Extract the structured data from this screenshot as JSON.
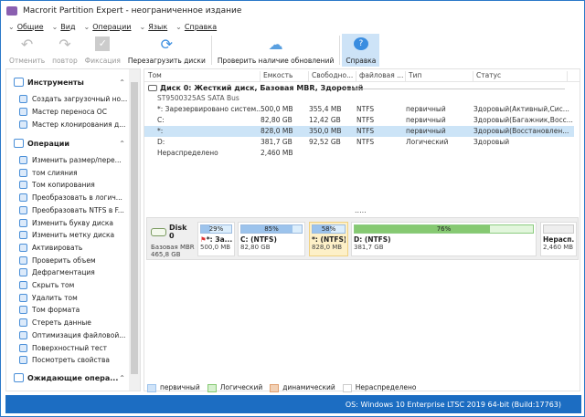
{
  "title": "Macrorit Partition Expert  - неограниченное издание",
  "menu": [
    "Общие",
    "Вид",
    "Операции",
    "Язык",
    "Справка"
  ],
  "toolbar": [
    {
      "label": "Отменить",
      "icon": "undo-icon",
      "enabled": false
    },
    {
      "label": "повтор",
      "icon": "redo-icon",
      "enabled": false
    },
    {
      "label": "Фиксация",
      "icon": "commit-icon",
      "enabled": false
    },
    {
      "label": "Перезагрузить диски",
      "icon": "reload-icon",
      "enabled": true
    },
    {
      "label": "Проверить наличие обновлений",
      "icon": "cloud-upload-icon",
      "enabled": true
    },
    {
      "label": "Справка",
      "icon": "help-icon",
      "enabled": true
    }
  ],
  "sidebar": {
    "tools_title": "Инструменты",
    "tools": [
      "Создать загрузочный но...",
      "Мастер переноса ОС",
      "Мастер клонирования д..."
    ],
    "ops_title": "Операции",
    "ops": [
      "Изменить размер/пере...",
      "том слияния",
      "Том копирования",
      "Преобразовать в логич...",
      "Преобразовать NTFS в F...",
      "Изменить букву диска",
      "Изменить метку диска",
      "Активировать",
      "Проверить объем",
      "Дефрагментация",
      "Скрыть том",
      "Удалить том",
      "Том формата",
      "Стереть данные",
      "Оптимизация файловой...",
      "Поверхностный тест",
      "Посмотреть свойства"
    ],
    "pending_title": "Ожидающие опера..."
  },
  "table": {
    "headers": [
      "Том",
      "Емкость",
      "Свободно...",
      "файловая ...",
      "Тип",
      "Статус"
    ],
    "disk_title": "Диск 0: Жесткий диск, Базовая MBR, Здоровый",
    "disk_bus": "ST9500325AS SATA Bus",
    "rows": [
      [
        "*: Зарезервировано систем...",
        "500,0 MB",
        "355,4 MB",
        "NTFS",
        "первичный",
        "Здоровый(Активный,Сис..."
      ],
      [
        "C:",
        "82,80 GB",
        "12,42 GB",
        "NTFS",
        "первичный",
        "Здоровый(Багажник,Восс..."
      ],
      [
        "*:",
        "828,0 MB",
        "350,0 MB",
        "NTFS",
        "первичный",
        "Здоровый(Восстановлен..."
      ],
      [
        "D:",
        "381,7 GB",
        "92,52 GB",
        "NTFS",
        "Логический",
        "Здоровый"
      ],
      [
        "Нераспределено",
        "2,460 MB",
        "",
        "",
        "",
        ""
      ]
    ],
    "selected_row": 2
  },
  "dots": ".....",
  "diskmap": {
    "disk": {
      "name": "Disk 0",
      "type": "Базовая MBR",
      "size": "465,8 GB"
    },
    "parts": [
      {
        "pct": "29%",
        "used": 29,
        "name": "*: За...",
        "size": "500,0 MB",
        "kind": "primary"
      },
      {
        "pct": "85%",
        "used": 85,
        "name": "C: (NTFS)",
        "size": "82,80 GB",
        "kind": "primary"
      },
      {
        "pct": "58%",
        "used": 58,
        "name": "*: (NTFS)",
        "size": "828,0 MB",
        "kind": "primary"
      },
      {
        "pct": "76%",
        "used": 76,
        "name": "D: (NTFS)",
        "size": "381,7 GB",
        "kind": "logical"
      },
      {
        "pct": "",
        "used": 0,
        "name": "Нерасп...",
        "size": "2,460 MB",
        "kind": "unallocated"
      }
    ]
  },
  "legend": [
    "первичный",
    "Логический",
    "динамический",
    "Нераспределено"
  ],
  "colors": {
    "primary": "#9cc3ec",
    "logical": "#86c972",
    "dynamic": "#e0a070",
    "status": "#1c6dc2"
  },
  "status": "OS: Windows 10 Enterprise LTSC 2019 64-bit (Build:17763)"
}
